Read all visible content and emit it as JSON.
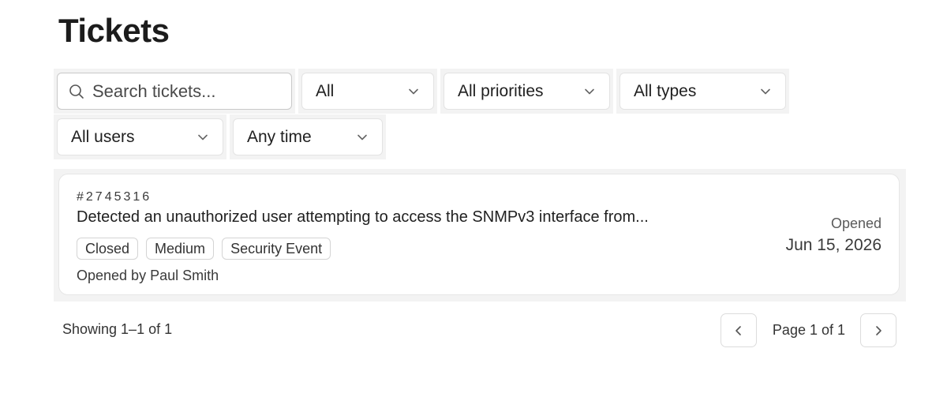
{
  "page": {
    "title": "Tickets"
  },
  "filters": {
    "search_placeholder": "Search tickets...",
    "status": "All",
    "priority": "All priorities",
    "type": "All types",
    "user": "All users",
    "time": "Any time"
  },
  "tickets": [
    {
      "id": "#2745316",
      "title": "Detected an unauthorized user attempting to access the SNMPv3 interface from...",
      "tags": [
        "Closed",
        "Medium",
        "Security Event"
      ],
      "opened_by": "Opened by Paul Smith",
      "opened_label": "Opened",
      "opened_date": "Jun 15, 2026"
    }
  ],
  "footer": {
    "showing": "Showing 1–1 of 1",
    "page_info": "Page 1 of 1"
  },
  "icons": {
    "search": "search-icon",
    "dropdown": "chevron-down-icon",
    "prev": "chevron-left-icon",
    "next": "chevron-right-icon"
  }
}
